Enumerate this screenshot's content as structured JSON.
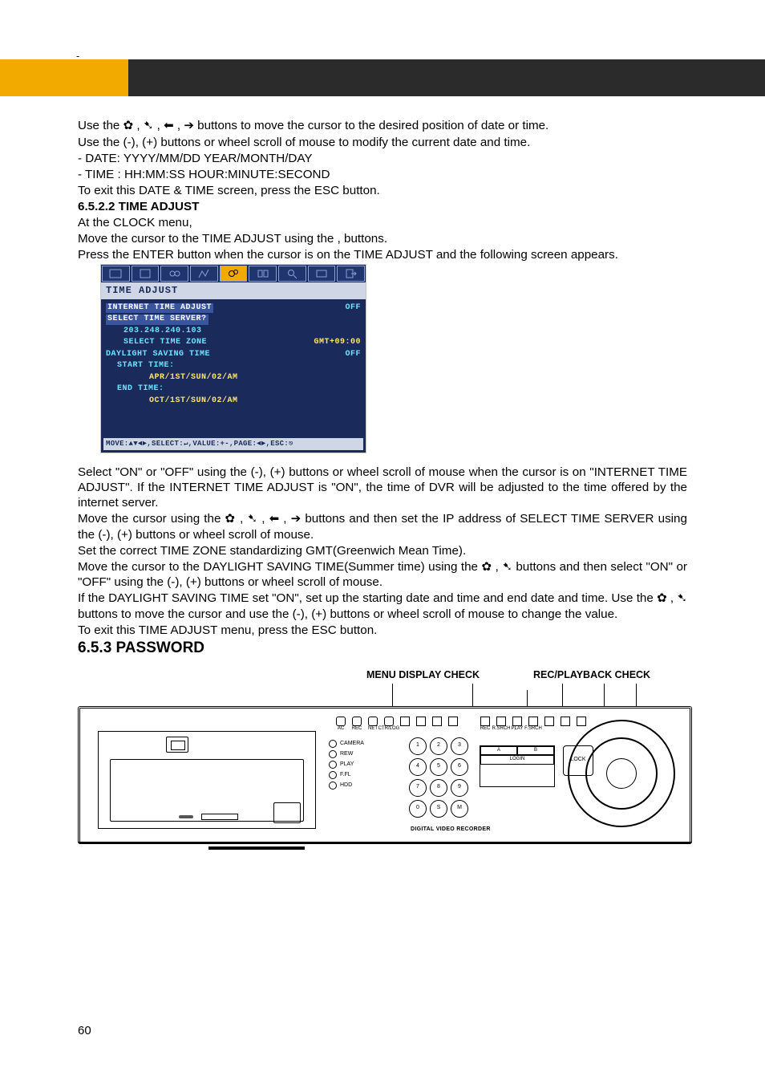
{
  "top_dash": "-",
  "intro": {
    "line1_a": "Use the ",
    "line1_b": " buttons to move the cursor to the desired position of date or time.",
    "line2": "Use the (-), (+) buttons or wheel scroll of mouse to modify the current date and time.",
    "bul1": "-   DATE: YYYY/MM/DD    YEAR/MONTH/DAY",
    "bul2": "-   TIME : HH:MM:SS        HOUR:MINUTE:SECOND",
    "line3": "To exit this DATE & TIME screen, press the ESC button."
  },
  "sec6522": {
    "heading": "6.5.2.2 TIME ADJUST",
    "p1": "At the CLOCK menu,",
    "p2": "Move the cursor to the TIME ADJUST using the , buttons.",
    "p3": "Press the ENTER button when the cursor is on the TIME ADJUST and the following screen appears."
  },
  "shot": {
    "title": "TIME ADJUST",
    "rows": {
      "r1l": "INTERNET TIME ADJUST",
      "r1r": "OFF",
      "r2l": "SELECT TIME SERVER?",
      "r3": "203.248.240.103",
      "r4l": "SELECT TIME ZONE",
      "r4r": "GMT+09:00",
      "r5l": "DAYLIGHT SAVING TIME",
      "r5r": "OFF",
      "r6": "START TIME:",
      "r7": "APR/1ST/SUN/02/AM",
      "r8": "END   TIME:",
      "r9": "OCT/1ST/SUN/02/AM"
    },
    "hint": "MOVE:▲▼◄►,SELECT:↵,VALUE:+-,PAGE:◄►,ESC:⎋"
  },
  "after": {
    "p1": "Select \"ON\" or \"OFF\" using the (-), (+) buttons or wheel scroll of mouse when the cursor is on \"INTERNET TIME ADJUST\". If the INTERNET TIME ADJUST is \"ON\", the time of DVR will be adjusted to the time offered by the internet server.",
    "p2a": "Move the cursor using the ",
    "p2b": " buttons and then set the IP address of SELECT TIME SERVER using the (-), (+) buttons or wheel scroll of mouse.",
    "p3": "Set the correct TIME ZONE standardizing GMT(Greenwich Mean Time).",
    "p4a": "Move the cursor to the DAYLIGHT SAVING TIME(Summer time) using the ",
    "p4b": " buttons and then select \"ON\" or \"OFF\" using the (-), (+) buttons or wheel scroll of mouse.",
    "p5a": "If the DAYLIGHT SAVING TIME set \"ON\", set up the starting date and time and end date and time. Use the ",
    "p5b": " buttons to move the cursor and use the (-), (+) buttons or wheel scroll of mouse to change the value.",
    "p6": "To exit this TIME ADJUST menu, press the ESC button."
  },
  "sec653": {
    "heading": "6.5.3  PASSWORD"
  },
  "device": {
    "label1": "MENU DISPLAY CHECK",
    "label2": "REC/PLAYBACK CHECK",
    "leds": [
      "CAMERA",
      "REW",
      "PLAY",
      "F.FL",
      "HDD"
    ],
    "top_strip": [
      "AC",
      "REC",
      "NET",
      "CTR/LOG",
      "",
      "",
      "",
      ""
    ],
    "trans_strip": [
      "REC",
      "R.SRCH",
      "PLAY",
      "F.SRCH",
      "",
      "",
      "",
      ""
    ],
    "grid": [
      "1",
      "2",
      "3",
      "4",
      "5",
      "6",
      "7",
      "8",
      "9",
      "0",
      "S",
      "M"
    ],
    "login": [
      "A",
      "B",
      "LOGIN"
    ],
    "lock": "LOCK",
    "model": "DIGITAL VIDEO RECORDER"
  },
  "arrows": {
    "up": "✦",
    "down": "✦",
    "left": "✦",
    "right": "➔",
    "sep": " , "
  },
  "page_no": "60"
}
